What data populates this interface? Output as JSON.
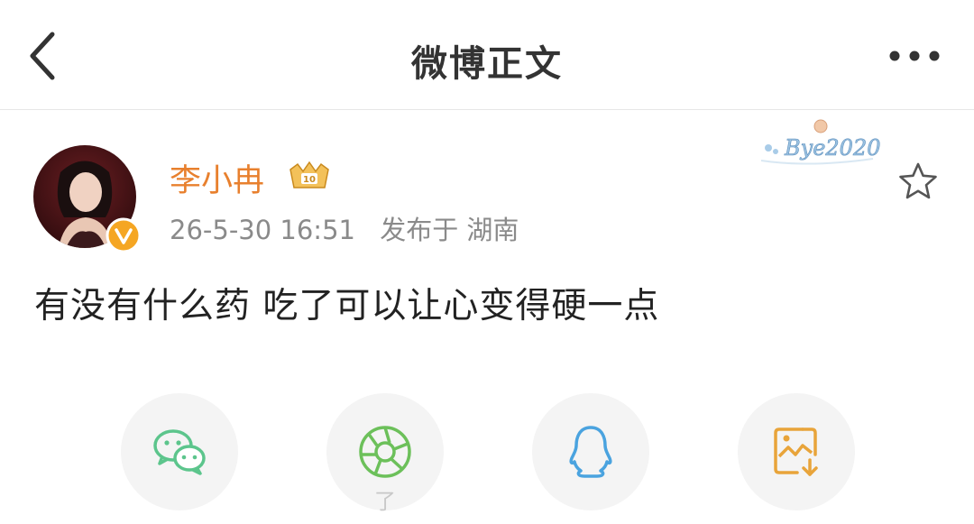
{
  "header": {
    "title": "微博正文",
    "back_icon": "chevron-left-icon",
    "more_icon": "more-dots-icon"
  },
  "post": {
    "author": "李小冉",
    "date": "26-5-30 16:51",
    "location": "发布于 湖南",
    "text": "有没有什么药 吃了可以让心变得硬一点",
    "decoration_text": "Bye2020"
  },
  "share_bar": [
    {
      "name": "wechat",
      "icon": "wechat-icon",
      "color": "#5cc58c"
    },
    {
      "name": "moments",
      "icon": "moments-icon",
      "color": "#5cc58c"
    },
    {
      "name": "qq",
      "icon": "qq-icon",
      "color": "#4aa3df"
    },
    {
      "name": "save-image",
      "icon": "save-image-icon",
      "color": "#e8a43a"
    }
  ],
  "watermark": "了",
  "colors": {
    "username": "#e8802e",
    "meta": "#8a8a8a",
    "badge": "#f5a623"
  }
}
